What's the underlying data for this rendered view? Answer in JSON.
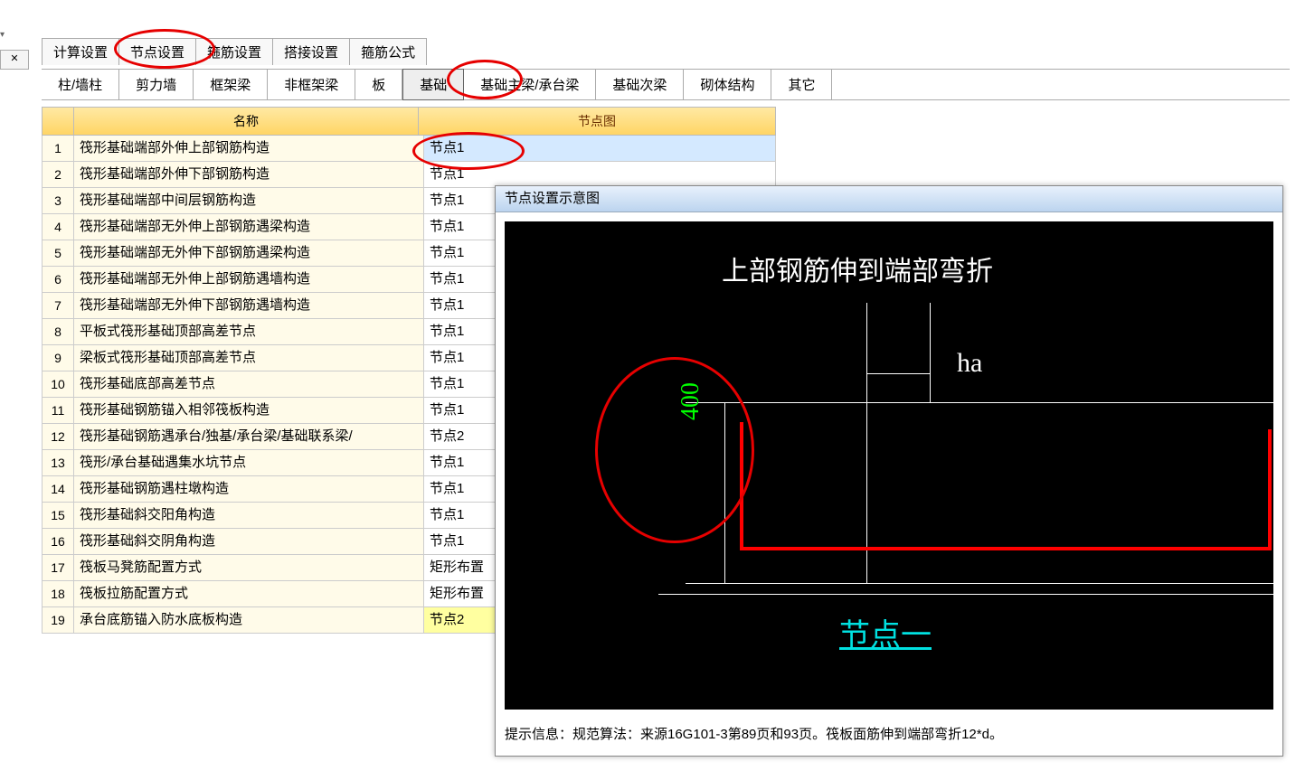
{
  "close_btn": "✕",
  "tabs1": {
    "calc": "计算设置",
    "node": "节点设置",
    "stirrup": "箍筋设置",
    "splice": "搭接设置",
    "formula": "箍筋公式"
  },
  "tabs2": {
    "col": "柱/墙柱",
    "shear": "剪力墙",
    "frame": "框架梁",
    "nonframe": "非框架梁",
    "slab": "板",
    "found": "基础",
    "foundbeam": "基础主梁/承台梁",
    "foundsec": "基础次梁",
    "masonry": "砌体结构",
    "other": "其它"
  },
  "headers": {
    "name": "名称",
    "diagram": "节点图"
  },
  "rows": [
    {
      "n": "1",
      "name": "筏形基础端部外伸上部钢筋构造",
      "v": "节点1"
    },
    {
      "n": "2",
      "name": "筏形基础端部外伸下部钢筋构造",
      "v": "节点1"
    },
    {
      "n": "3",
      "name": "筏形基础端部中间层钢筋构造",
      "v": "节点1"
    },
    {
      "n": "4",
      "name": "筏形基础端部无外伸上部钢筋遇梁构造",
      "v": "节点1"
    },
    {
      "n": "5",
      "name": "筏形基础端部无外伸下部钢筋遇梁构造",
      "v": "节点1"
    },
    {
      "n": "6",
      "name": "筏形基础端部无外伸上部钢筋遇墙构造",
      "v": "节点1"
    },
    {
      "n": "7",
      "name": "筏形基础端部无外伸下部钢筋遇墙构造",
      "v": "节点1"
    },
    {
      "n": "8",
      "name": "平板式筏形基础顶部高差节点",
      "v": "节点1"
    },
    {
      "n": "9",
      "name": "梁板式筏形基础顶部高差节点",
      "v": "节点1"
    },
    {
      "n": "10",
      "name": "筏形基础底部高差节点",
      "v": "节点1"
    },
    {
      "n": "11",
      "name": "筏形基础钢筋锚入相邻筏板构造",
      "v": "节点1"
    },
    {
      "n": "12",
      "name": "筏形基础钢筋遇承台/独基/承台梁/基础联系梁/",
      "v": "节点2"
    },
    {
      "n": "13",
      "name": "筏形/承台基础遇集水坑节点",
      "v": "节点1"
    },
    {
      "n": "14",
      "name": "筏形基础钢筋遇柱墩构造",
      "v": "节点1"
    },
    {
      "n": "15",
      "name": "筏形基础斜交阳角构造",
      "v": "节点1"
    },
    {
      "n": "16",
      "name": "筏形基础斜交阴角构造",
      "v": "节点1"
    },
    {
      "n": "17",
      "name": "筏板马凳筋配置方式",
      "v": "矩形布置"
    },
    {
      "n": "18",
      "name": "筏板拉筋配置方式",
      "v": "矩形布置"
    },
    {
      "n": "19",
      "name": "承台底筋锚入防水底板构造",
      "v": "节点2"
    }
  ],
  "diagram": {
    "title": "节点设置示意图",
    "main_text": "上部钢筋伸到端部弯折",
    "dim_ha": "ha",
    "dim_400": "400",
    "node_label": "节点一",
    "footer": "提示信息：规范算法：来源16G101-3第89页和93页。筏板面筋伸到端部弯折12*d。"
  }
}
